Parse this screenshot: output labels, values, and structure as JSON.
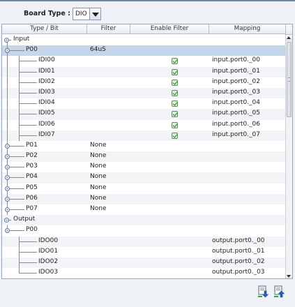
{
  "board": {
    "label": "Board Type :",
    "value": "DIO"
  },
  "columns": [
    "Type / Bit",
    "Filter",
    "Enable Filter",
    "Mapping"
  ],
  "rows": [
    {
      "label": "Input",
      "level": 0,
      "filter": "",
      "checked": false,
      "mapping": ""
    },
    {
      "label": "P00",
      "level": 1,
      "filter": "64uS",
      "checked": false,
      "mapping": "",
      "selected": true
    },
    {
      "label": "IDI00",
      "level": 2,
      "filter": "",
      "checked": true,
      "mapping": "input.port0._00"
    },
    {
      "label": "IDI01",
      "level": 2,
      "filter": "",
      "checked": true,
      "mapping": "input.port0._01"
    },
    {
      "label": "IDI02",
      "level": 2,
      "filter": "",
      "checked": true,
      "mapping": "input.port0._02"
    },
    {
      "label": "IDI03",
      "level": 2,
      "filter": "",
      "checked": true,
      "mapping": "input.port0._03"
    },
    {
      "label": "IDI04",
      "level": 2,
      "filter": "",
      "checked": true,
      "mapping": "input.port0._04"
    },
    {
      "label": "IDI05",
      "level": 2,
      "filter": "",
      "checked": true,
      "mapping": "input.port0._05"
    },
    {
      "label": "IDI06",
      "level": 2,
      "filter": "",
      "checked": true,
      "mapping": "input.port0._06"
    },
    {
      "label": "IDI07",
      "level": 2,
      "filter": "",
      "checked": true,
      "mapping": "input.port0._07"
    },
    {
      "label": "P01",
      "level": 1,
      "filter": "None",
      "checked": false,
      "mapping": ""
    },
    {
      "label": "P02",
      "level": 1,
      "filter": "None",
      "checked": false,
      "mapping": ""
    },
    {
      "label": "P03",
      "level": 1,
      "filter": "None",
      "checked": false,
      "mapping": ""
    },
    {
      "label": "P04",
      "level": 1,
      "filter": "None",
      "checked": false,
      "mapping": ""
    },
    {
      "label": "P05",
      "level": 1,
      "filter": "None",
      "checked": false,
      "mapping": ""
    },
    {
      "label": "P06",
      "level": 1,
      "filter": "None",
      "checked": false,
      "mapping": ""
    },
    {
      "label": "P07",
      "level": 1,
      "filter": "None",
      "checked": false,
      "mapping": ""
    },
    {
      "label": "Output",
      "level": 0,
      "filter": "",
      "checked": false,
      "mapping": ""
    },
    {
      "label": "P00",
      "level": 1,
      "filter": "",
      "checked": false,
      "mapping": ""
    },
    {
      "label": "IDO00",
      "level": 2,
      "filter": "",
      "checked": false,
      "mapping": "output.port0._00"
    },
    {
      "label": "IDO01",
      "level": 2,
      "filter": "",
      "checked": false,
      "mapping": "output.port0._01"
    },
    {
      "label": "IDO02",
      "level": 2,
      "filter": "",
      "checked": false,
      "mapping": "output.port0._02"
    },
    {
      "label": "IDO03",
      "level": 2,
      "filter": "",
      "checked": false,
      "mapping": "output.port0._03"
    }
  ],
  "toolbar": {
    "import_icon": "import-icon",
    "export_icon": "export-icon"
  },
  "colors": {
    "selected_row": "#c6d6ea",
    "check_green": "#2f7d2f",
    "icon_blue": "#2a62b8"
  }
}
